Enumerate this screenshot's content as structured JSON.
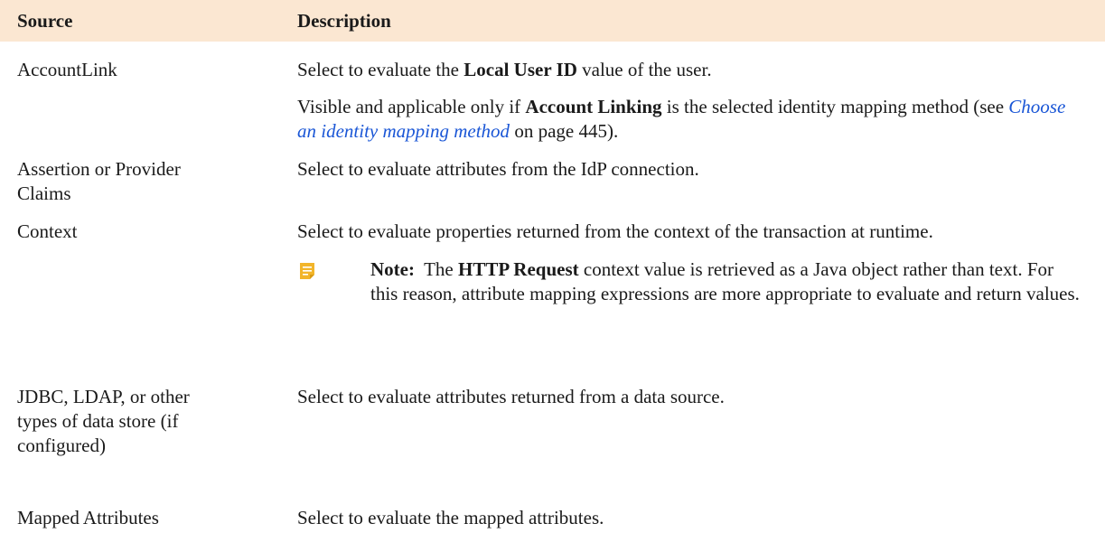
{
  "header": {
    "source": "Source",
    "description": "Description"
  },
  "rows": [
    {
      "source": "AccountLink",
      "desc_pre": "Select to evaluate the ",
      "desc_bold": "Local User ID",
      "desc_post": " value of the user.",
      "extra_pre": "Visible and applicable only if ",
      "extra_bold": "Account Linking",
      "extra_mid": " is the selected identity mapping method (see ",
      "extra_link": "Choose an identity mapping method",
      "extra_post": " on page 445)."
    },
    {
      "source": "Assertion or Provider Claims",
      "desc": "Select to evaluate attributes from the IdP connection."
    },
    {
      "source": "Context",
      "desc": "Select to evaluate properties returned from the context of the transaction at runtime.",
      "note_label": "Note:",
      "note_pre": "The ",
      "note_bold": "HTTP Request",
      "note_post": " context value is retrieved as a Java object rather than text. For this reason, attribute mapping expressions are more appropriate to evaluate and return values."
    },
    {
      "source": "JDBC, LDAP, or other types of data store (if configured)",
      "desc": "Select to evaluate attributes returned from a data source."
    },
    {
      "source": "Mapped Attributes",
      "desc": "Select to evaluate the mapped attributes."
    }
  ],
  "colors": {
    "header_bg": "#fbe7d2",
    "link": "#1a56d6",
    "note_icon": "#f2b52a"
  },
  "icons": {
    "note": "note-icon"
  }
}
